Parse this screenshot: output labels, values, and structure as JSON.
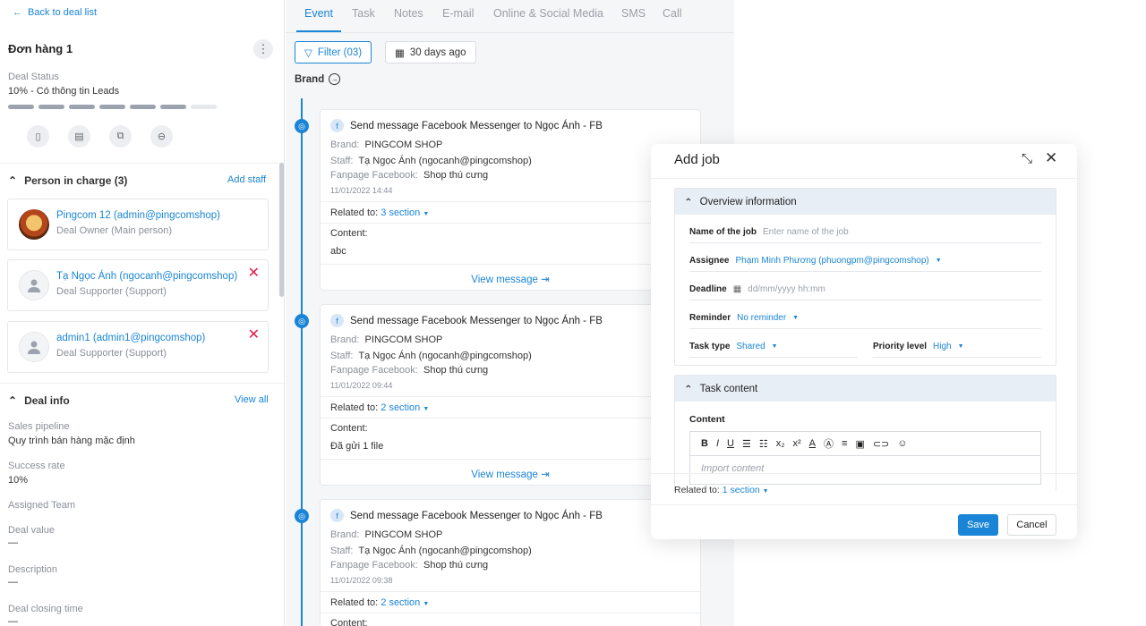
{
  "left": {
    "back_label": "Back to deal list",
    "deal_title": "Đơn hàng 1",
    "status_label": "Deal Status",
    "status_value": "10% - Có thông tin Leads",
    "progress_filled": 6,
    "progress_total": 7,
    "action_icons": [
      "phone-icon",
      "note-icon",
      "transfer-icon",
      "convert-icon"
    ],
    "person_section": {
      "title": "Person in charge (3)",
      "link": "Add staff"
    },
    "persons": [
      {
        "name": "Pingcom 12 (admin@pingcomshop)",
        "role": "Deal Owner (Main person)",
        "removable": false
      },
      {
        "name": "Tạ Ngọc Ánh (ngocanh@pingcomshop)",
        "role": "Deal Supporter (Support)",
        "removable": true
      },
      {
        "name": "admin1 (admin1@pingcomshop)",
        "role": "Deal Supporter (Support)",
        "removable": true
      }
    ],
    "deal_info": {
      "title": "Deal info",
      "link": "View all",
      "fields": [
        {
          "label": "Sales pipeline",
          "value": "Quy trình bán hàng mặc định"
        },
        {
          "label": "Success rate",
          "value": "10%"
        },
        {
          "label": "Assigned Team",
          "value": ""
        },
        {
          "label": "Deal value",
          "value": "—"
        },
        {
          "label": "Description",
          "value": "—"
        },
        {
          "label": "Deal closing time",
          "value": "—"
        }
      ]
    }
  },
  "middle": {
    "tabs": [
      "Event",
      "Task",
      "Notes",
      "E-mail",
      "Online & Social Media",
      "SMS",
      "Call"
    ],
    "active_tab": "Event",
    "filter_label": "Filter (03)",
    "date_label": "30 days ago",
    "brand_label": "Brand",
    "events": [
      {
        "title": "Send message Facebook Messenger to Ngọc Ánh - FB",
        "brand_k": "Brand:",
        "brand_v": "PINGCOM SHOP",
        "staff_k": "Staff:",
        "staff_v": "Tạ Ngọc Ánh (ngocanh@pingcomshop)",
        "fanpage_k": "Fanpage Facebook:",
        "fanpage_v": "Shop thú cưng",
        "date": "11/01/2022 14:44",
        "related_k": "Related to:",
        "related_v": "3 section",
        "content_k": "Content:",
        "content_v": "abc",
        "view": "View message"
      },
      {
        "title": "Send message Facebook Messenger to Ngọc Ánh - FB",
        "brand_k": "Brand:",
        "brand_v": "PINGCOM SHOP",
        "staff_k": "Staff:",
        "staff_v": "Tạ Ngọc Ánh (ngocanh@pingcomshop)",
        "fanpage_k": "Fanpage Facebook:",
        "fanpage_v": "Shop thú cưng",
        "date": "11/01/2022 09:44",
        "related_k": "Related to:",
        "related_v": "2 section",
        "content_k": "Content:",
        "content_v": "Đã gửi 1 file",
        "view": "View message"
      },
      {
        "title": "Send message Facebook Messenger to Ngọc Ánh - FB",
        "brand_k": "Brand:",
        "brand_v": "PINGCOM SHOP",
        "staff_k": "Staff:",
        "staff_v": "Tạ Ngọc Ánh (ngocanh@pingcomshop)",
        "fanpage_k": "Fanpage Facebook:",
        "fanpage_v": "Shop thú cưng",
        "date": "11/01/2022 09:38",
        "related_k": "Related to:",
        "related_v": "2 section",
        "content_k": "Content:",
        "content_v": "",
        "view": ""
      }
    ]
  },
  "modal": {
    "title": "Add job",
    "overview": {
      "title": "Overview information",
      "name_label": "Name of the job",
      "name_placeholder": "Enter name of the job",
      "assignee_label": "Assignee",
      "assignee_value": "Phạm Minh Phương (phuongpm@pingcomshop)",
      "deadline_label": "Deadline",
      "deadline_placeholder": "dd/mm/yyyy hh:mm",
      "reminder_label": "Reminder",
      "reminder_value": "No reminder",
      "tasktype_label": "Task type",
      "tasktype_value": "Shared",
      "priority_label": "Priority level",
      "priority_value": "High"
    },
    "task_content": {
      "title": "Task content",
      "content_label": "Content",
      "placeholder": "Import content"
    },
    "related_k": "Related to:",
    "related_v": "1 section",
    "save": "Save",
    "cancel": "Cancel"
  }
}
